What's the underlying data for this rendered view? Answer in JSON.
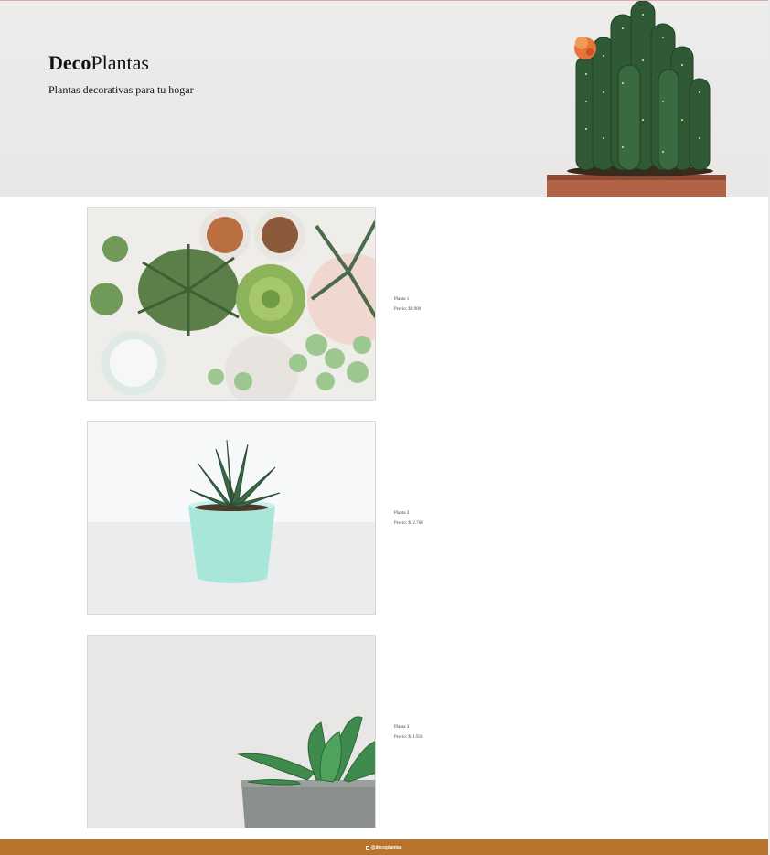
{
  "header": {
    "brand_bold": "Deco",
    "brand_regular": "Plantas",
    "tagline": "Plantas decorativas para tu hogar"
  },
  "products": [
    {
      "name": "Planta 1",
      "price": "Precio: $9.900"
    },
    {
      "name": "Planta 2",
      "price": "Precio: $12.760"
    },
    {
      "name": "Planta 3",
      "price": "Precio: $11.950"
    }
  ],
  "footer": {
    "instagram": "@decoplantas"
  },
  "colors": {
    "hero_bg": "#ebeae8",
    "footer_bg": "#b8732c",
    "pot": "#b26245"
  }
}
